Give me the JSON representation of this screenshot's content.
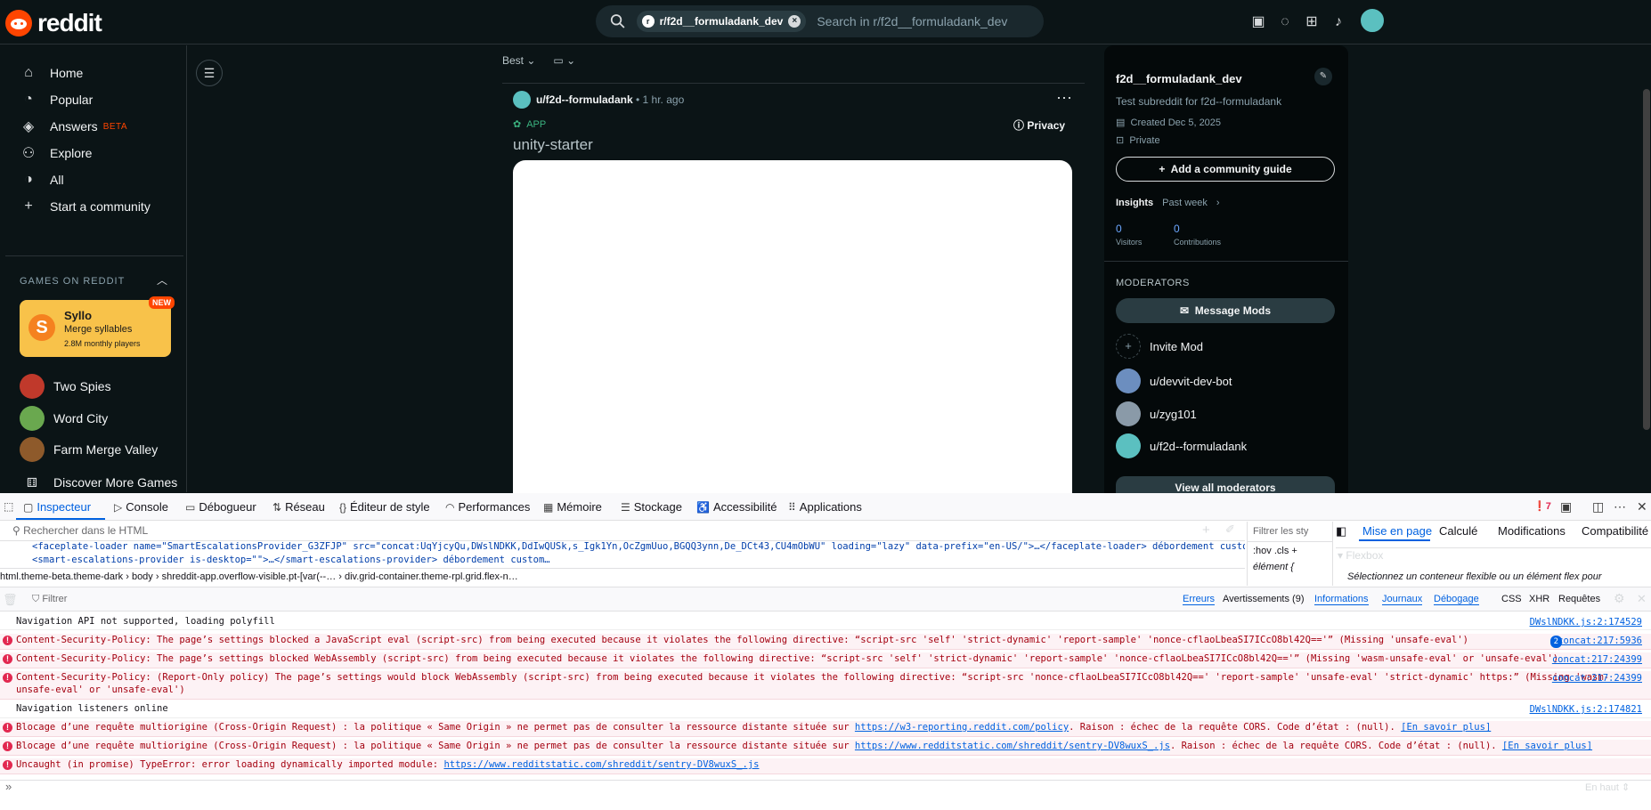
{
  "header": {
    "logo_text": "reddit",
    "search_chip": "r/f2d__formuladank_dev",
    "search_placeholder": "Search in r/f2d__formuladank_dev",
    "icons": [
      "ads-icon",
      "chat-icon",
      "create-icon",
      "bell-icon",
      "avatar"
    ]
  },
  "sidebar": {
    "items": [
      {
        "label": "Home",
        "icon": "home-icon"
      },
      {
        "label": "Popular",
        "icon": "popular-icon"
      },
      {
        "label": "Answers",
        "icon": "answers-icon",
        "badge": "BETA"
      },
      {
        "label": "Explore",
        "icon": "explore-icon"
      },
      {
        "label": "All",
        "icon": "all-icon"
      },
      {
        "label": "Start a community",
        "icon": "plus-icon"
      }
    ],
    "games_title": "GAMES ON REDDIT",
    "featured_game": {
      "name": "Syllo",
      "tagline": "Merge syllables",
      "players": "2.8M monthly players",
      "badge": "NEW",
      "logo": "S"
    },
    "games": [
      {
        "name": "Two Spies",
        "color": "#c0392b"
      },
      {
        "name": "Word City",
        "color": "#6aa84f"
      },
      {
        "name": "Farm Merge Valley",
        "color": "#8e5a2b"
      },
      {
        "name": "Discover More Games",
        "color": "#d7dadc"
      }
    ]
  },
  "feed": {
    "sort_label": "Best",
    "post": {
      "user": "u/f2d--formuladank",
      "time": "• 1 hr. ago",
      "app_badge": "APP",
      "privacy": "Privacy",
      "title": "unity-starter"
    }
  },
  "community": {
    "name": "f2d__formuladank_dev",
    "description": "Test subreddit for f2d--formuladank",
    "created": "Created Dec 5, 2025",
    "visibility": "Private",
    "guide_button": "Add a community guide",
    "insights_label": "Insights",
    "insights_period": "Past week",
    "visitors": {
      "value": "0",
      "label": "Visitors"
    },
    "contributions": {
      "value": "0",
      "label": "Contributions"
    },
    "moderators_title": "MODERATORS",
    "message_button": "Message Mods",
    "invite_label": "Invite Mod",
    "moderators": [
      {
        "name": "u/devvit-dev-bot",
        "color": "#6c8ebf"
      },
      {
        "name": "u/zyg101",
        "color": "#8a9aa8"
      },
      {
        "name": "u/f2d--formuladank",
        "color": "#5bc0c0"
      }
    ],
    "view_all": "View all moderators"
  },
  "devtools": {
    "tabs": [
      "Inspecteur",
      "Console",
      "Débogueur",
      "Réseau",
      "Éditeur de style",
      "Performances",
      "Mémoire",
      "Stockage",
      "Accessibilité",
      "Applications"
    ],
    "error_count": "7",
    "html_search_placeholder": "Rechercher dans le HTML",
    "html_line1": "<faceplate-loader name=\"SmartEscalationsProvider_G3ZFJP\" src=\"concat:UqYjcyQu,DWslNDKK,DdIwQUSk,s_Igk1Yn,OcZgmUuo,BGQQ3ynn,De_DCt43,CU4mObWU\" loading=\"lazy\" data-prefix=\"en-US/\">…</faceplate-loader>  débordement  custom…",
    "html_line2": "<smart-escalations-provider is-desktop=\"\">…</smart-escalations-provider>  débordement  custom…",
    "breadcrumb": "html.theme-beta.theme-dark  ›  body  ›  shreddit-app.overflow-visible.pt-[var(--…  ›  div.grid-container.theme-rpl.grid.flex-n…",
    "rules_filter": "Filtrer les sty",
    "rules_hov": ":hov  .cls  +",
    "rules_element": "élément  {",
    "layout_tabs": [
      "Mise en page",
      "Calculé",
      "Modifications",
      "Compatibilité"
    ],
    "flexbox_label": "Flexbox",
    "flexbox_hint": "Sélectionnez un conteneur flexible ou un élément flex pour",
    "console_filter_placeholder": "Filtrer",
    "console_filters": [
      "Erreurs",
      "Avertissements (9)",
      "Informations",
      "Journaux",
      "Débogage",
      "CSS",
      "XHR",
      "Requêtes"
    ],
    "log": [
      {
        "type": "info",
        "text": "Navigation API not supported, loading polyfill",
        "src": "DWslNDKK.js:2:174529"
      },
      {
        "type": "err",
        "text": "Content-Security-Policy: The page’s settings blocked a JavaScript eval (script-src) from being executed because it violates the following directive: “script-src 'self' 'strict-dynamic' 'report-sample' 'nonce-cflaoLbeaSI7ICcO8bl42Q=='” (Missing 'unsafe-eval')",
        "src": "concat:217:5936",
        "count": "2"
      },
      {
        "type": "err",
        "text": "Content-Security-Policy: The page’s settings blocked WebAssembly (script-src) from being executed because it violates the following directive: “script-src 'self' 'strict-dynamic' 'report-sample' 'nonce-cflaoLbeaSI7ICcO8bl42Q=='” (Missing 'wasm-unsafe-eval' or 'unsafe-eval')",
        "src": "concat:217:24399"
      },
      {
        "type": "err",
        "text": "Content-Security-Policy: (Report-Only policy) The page’s settings would block WebAssembly (script-src) from being executed because it violates the following directive: “script-src 'nonce-cflaoLbeaSI7ICcO8bl42Q==' 'report-sample' 'unsafe-eval' 'strict-dynamic' https:” (Missing 'wasm-",
        "text2": "unsafe-eval' or 'unsafe-eval')",
        "src": "concat:217:24399"
      },
      {
        "type": "info",
        "text": "Navigation listeners online",
        "src": "DWslNDKK.js:2:174821"
      },
      {
        "type": "err",
        "text": "Blocage d’une requête multiorigine (Cross-Origin Request) : la politique « Same Origin » ne permet pas de consulter la ressource distante située sur ",
        "link": "https://w3-reporting.reddit.com/policy",
        "tail": ". Raison : échec de la requête CORS. Code d’état : (null). ",
        "more": "[En savoir plus]"
      },
      {
        "type": "err",
        "text": "Blocage d’une requête multiorigine (Cross-Origin Request) : la politique « Same Origin » ne permet pas de consulter la ressource distante située sur ",
        "link": "https://www.redditstatic.com/shreddit/sentry-DV8wuxS_.js",
        "tail": ". Raison : échec de la requête CORS. Code d’état : (null). ",
        "more": "[En savoir plus]"
      },
      {
        "type": "err",
        "text": "Uncaught (in promise) TypeError: error loading dynamically imported module: ",
        "link": "https://www.redditstatic.com/shreddit/sentry-DV8wuxS_.js"
      }
    ],
    "position_select": "En haut"
  }
}
